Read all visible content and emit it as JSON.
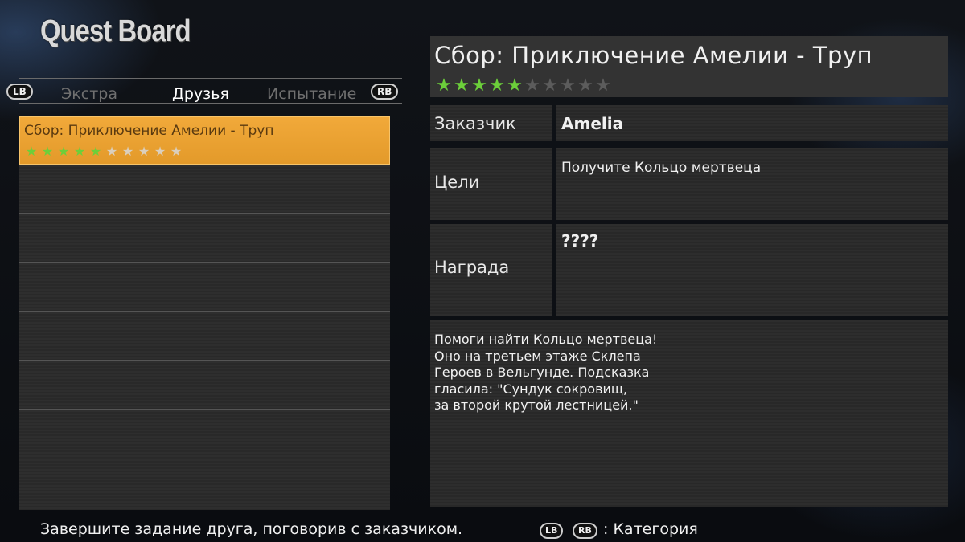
{
  "header": {
    "title": "Quest Board"
  },
  "tabs": {
    "left_button": "LB",
    "right_button": "RB",
    "items": [
      {
        "label": "Экстра",
        "active": false
      },
      {
        "label": "Друзья",
        "active": true
      },
      {
        "label": "Испытание",
        "active": false
      }
    ]
  },
  "quest_list": {
    "items": [
      {
        "title": "Сбор: Приключение Амелии - Труп",
        "difficulty": 5,
        "max": 10,
        "selected": true
      }
    ],
    "empty_rows": 7
  },
  "detail": {
    "name": "Сбор: Приключение Амелии - Труп",
    "difficulty": 5,
    "max": 10,
    "client_label": "Заказчик",
    "client_value": "Amelia",
    "goal_label": "Цели",
    "goal_value": "Получите Кольцо мертвеца",
    "reward_label": "Награда",
    "reward_value": "????",
    "description": "Помоги найти Кольцо мертвеца!\nОно на третьем этаже Склепа\nГероев в Вельгунде. Подсказка\nгласила: \"Сундук сокровищ,\nза второй крутой лестницей.\""
  },
  "footer": {
    "hint": "Завершите задание друга, поговорив с заказчиком.",
    "lb": "LB",
    "rb": "RB",
    "category": ": Категория"
  },
  "colors": {
    "selected_row": "#e9a032",
    "star_filled": "#6ccf3a"
  }
}
